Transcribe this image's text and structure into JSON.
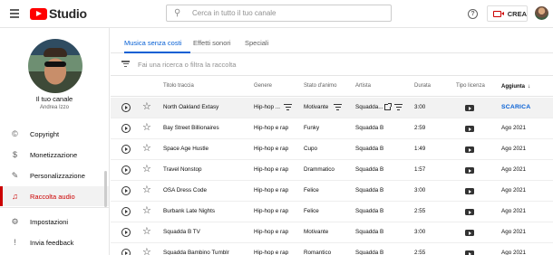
{
  "header": {
    "brand": "Studio",
    "search_placeholder": "Cerca in tutto il tuo canale",
    "help_icon": "?",
    "create_label": "CREA"
  },
  "sidebar": {
    "channel_title": "Il tuo canale",
    "channel_name": "Andrea Izzo",
    "items": [
      {
        "label": "Copyright",
        "icon": "copyright-icon",
        "glyph": "©"
      },
      {
        "label": "Monetizzazione",
        "icon": "dollar-icon",
        "glyph": "$"
      },
      {
        "label": "Personalizzazione",
        "icon": "magic-wand-icon",
        "glyph": "✎"
      },
      {
        "label": "Raccolta audio",
        "icon": "audio-library-icon",
        "glyph": "♫",
        "active": true
      },
      {
        "label": "Impostazioni",
        "icon": "gear-icon",
        "glyph": "⚙"
      },
      {
        "label": "Invia feedback",
        "icon": "feedback-icon",
        "glyph": "!"
      }
    ]
  },
  "tabs": [
    {
      "label": "Musica senza costi",
      "active": true
    },
    {
      "label": "Effetti sonori"
    },
    {
      "label": "Speciali"
    }
  ],
  "filter": {
    "placeholder": "Fai una ricerca o filtra la raccolta"
  },
  "columns": {
    "title": "Titolo traccia",
    "genre": "Genere",
    "mood": "Stato d'animo",
    "artist": "Artista",
    "duration": "Durata",
    "license": "Tipo licenza",
    "added": "Aggiunta"
  },
  "download_label": "SCARICA",
  "rows": [
    {
      "title": "North Oakland Extasy",
      "genre": "Hip-hop ...",
      "mood": "Motivante",
      "artist": "Squadda...",
      "duration": "3:00",
      "added": "SCARICA",
      "hover": true
    },
    {
      "title": "Bay Street Billionaires",
      "genre": "Hip-hop e rap",
      "mood": "Funky",
      "artist": "Squadda B",
      "duration": "2:59",
      "added": "Ago 2021"
    },
    {
      "title": "Space Age Hustle",
      "genre": "Hip-hop e rap",
      "mood": "Cupo",
      "artist": "Squadda B",
      "duration": "1:49",
      "added": "Ago 2021"
    },
    {
      "title": "Travel Nonstop",
      "genre": "Hip-hop e rap",
      "mood": "Drammatico",
      "artist": "Squadda B",
      "duration": "1:57",
      "added": "Ago 2021"
    },
    {
      "title": "OSA Dress Code",
      "genre": "Hip-hop e rap",
      "mood": "Felice",
      "artist": "Squadda B",
      "duration": "3:00",
      "added": "Ago 2021"
    },
    {
      "title": "Burbank Late Nights",
      "genre": "Hip-hop e rap",
      "mood": "Felice",
      "artist": "Squadda B",
      "duration": "2:55",
      "added": "Ago 2021"
    },
    {
      "title": "Squadda B TV",
      "genre": "Hip-hop e rap",
      "mood": "Motivante",
      "artist": "Squadda B",
      "duration": "3:00",
      "added": "Ago 2021"
    },
    {
      "title": "Squadda Bambino Tumblr",
      "genre": "Hip-hop e rap",
      "mood": "Romantico",
      "artist": "Squadda B",
      "duration": "2:55",
      "added": "Ago 2021"
    }
  ],
  "colors": {
    "accent": "#cc0000",
    "link": "#065fd4",
    "brand_red": "#ff0000"
  }
}
